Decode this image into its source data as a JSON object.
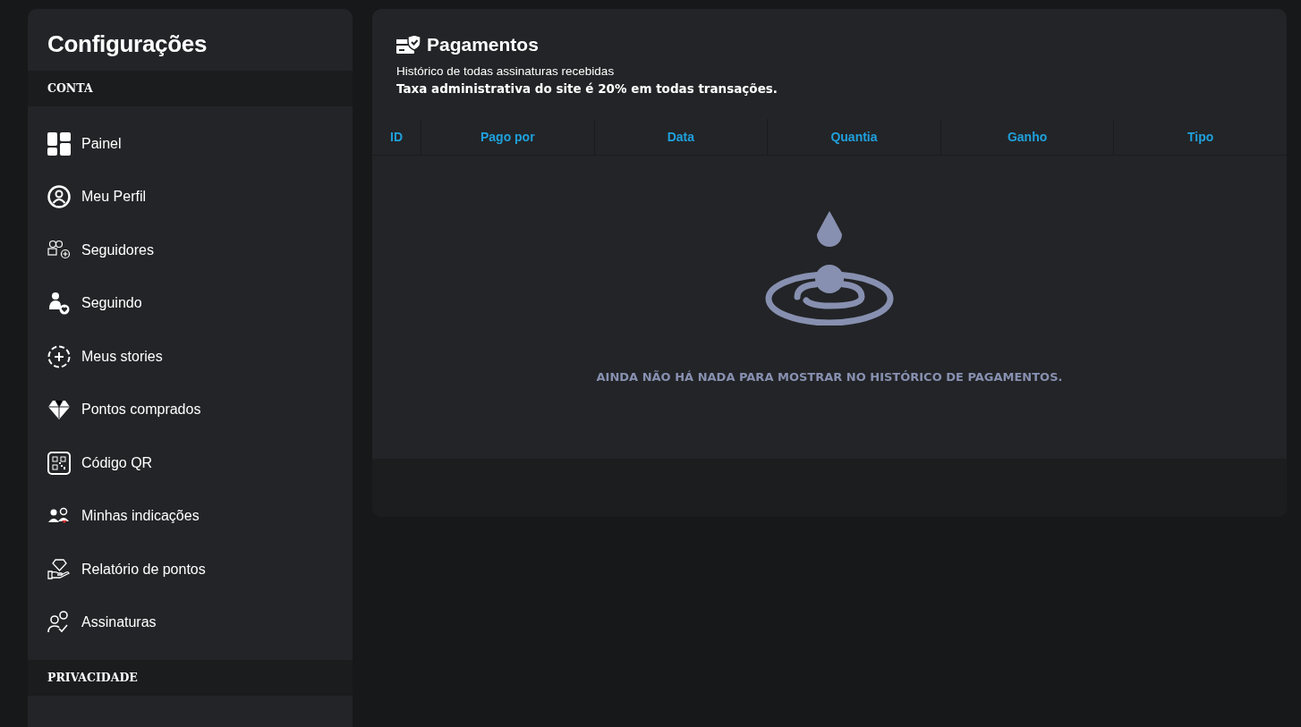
{
  "sidebar": {
    "title": "Configurações",
    "sections": [
      {
        "label": "CONTA",
        "items": [
          {
            "label": "Painel",
            "kind": "panel"
          },
          {
            "label": "Meu Perfil",
            "kind": "profile"
          },
          {
            "label": "Seguidores",
            "kind": "followers"
          },
          {
            "label": "Seguindo",
            "kind": "following"
          },
          {
            "label": "Meus stories",
            "kind": "stories"
          },
          {
            "label": "Pontos comprados",
            "kind": "diamond"
          },
          {
            "label": "Código QR",
            "kind": "qr"
          },
          {
            "label": "Minhas indicações",
            "kind": "referrals"
          },
          {
            "label": "Relatório de pontos",
            "kind": "report"
          },
          {
            "label": "Assinaturas",
            "kind": "subscriptions"
          }
        ]
      },
      {
        "label": "PRIVACIDADE"
      }
    ]
  },
  "payments": {
    "title": "Pagamentos",
    "subtitle": "Histórico de todas assinaturas recebidas",
    "note": "Taxa administrativa do site é 20% em todas transações.",
    "table": {
      "columns": [
        "ID",
        "Pago por",
        "Data",
        "Quantia",
        "Ganho",
        "Tipo"
      ]
    },
    "empty_message": "AINDA NÃO HÁ NADA PARA MOSTRAR NO HISTÓRICO DE PAGAMENTOS."
  }
}
